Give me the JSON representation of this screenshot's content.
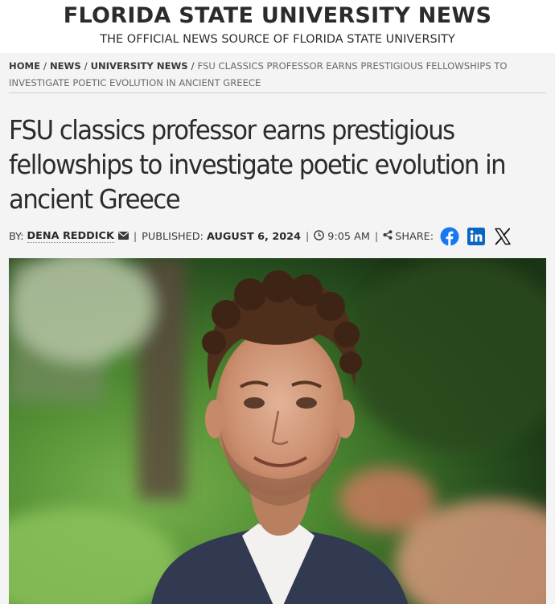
{
  "site": {
    "title": "FLORIDA STATE UNIVERSITY NEWS",
    "tagline": "THE OFFICIAL NEWS SOURCE OF FLORIDA STATE UNIVERSITY"
  },
  "breadcrumb": {
    "items": [
      "HOME",
      "NEWS",
      "UNIVERSITY NEWS"
    ],
    "separator": "/",
    "current": "FSU CLASSICS PROFESSOR EARNS PRESTIGIOUS FELLOWSHIPS TO INVESTIGATE POETIC EVOLUTION IN ANCIENT GREECE"
  },
  "article": {
    "headline": "FSU classics professor earns prestigious fellowships to investigate poetic evolution in ancient Greece",
    "byline": {
      "by_label": "BY:",
      "author": "DENA REDDICK",
      "published_label": "PUBLISHED:",
      "date": "AUGUST 6, 2024",
      "time": "9:05 AM",
      "share_label": "SHARE:",
      "divider": "|"
    }
  },
  "icons": {
    "mail": "envelope-icon",
    "clock": "clock-icon",
    "share": "share-icon",
    "facebook": "facebook-icon",
    "linkedin": "linkedin-icon",
    "x": "x-icon"
  },
  "colors": {
    "facebook": "#1877f2",
    "linkedin": "#0a66c2",
    "x": "#111111",
    "text": "#2b2b2b",
    "background": "#f4f4f4"
  }
}
